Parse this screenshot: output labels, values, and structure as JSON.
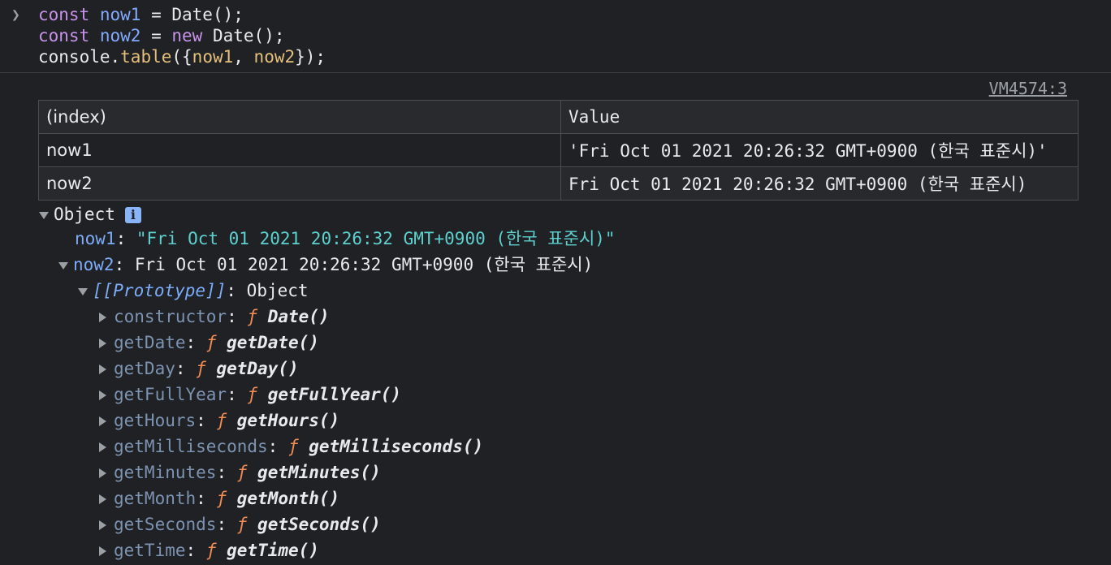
{
  "input": {
    "prompt_icon": "chevron-right",
    "line1": {
      "kw": "const",
      "var": "now1",
      "rest": " = Date();"
    },
    "line2": {
      "kw": "const",
      "var": "now2",
      "op": " = ",
      "kw2": "new",
      "rest": " Date();"
    },
    "line3": {
      "obj": "console.",
      "fn": "table",
      "open": "({",
      "a": "now1",
      "sep": ", ",
      "b": "now2",
      "close": "});"
    }
  },
  "source_link": "VM4574:3",
  "table": {
    "headers": [
      "(index)",
      "Value"
    ],
    "rows": [
      {
        "index": "now1",
        "value": "'Fri Oct 01 2021 20:26:32 GMT+0900 (한국 표준시)'"
      },
      {
        "index": "now2",
        "value": "Fri Oct 01 2021 20:26:32 GMT+0900 (한국 표준시)"
      }
    ]
  },
  "tree": {
    "root_label": "Object",
    "info_icon": "i",
    "now1_key": "now1",
    "now1_value": "\"Fri Oct 01 2021 20:26:32 GMT+0900 (한국 표준시)\"",
    "now2_key": "now2",
    "now2_value": "Fri Oct 01 2021 20:26:32 GMT+0900 (한국 표준시)",
    "proto_key": "[[Prototype]]",
    "proto_value": "Object",
    "f_glyph": "ƒ",
    "methods": [
      {
        "key": "constructor",
        "fn": "Date()"
      },
      {
        "key": "getDate",
        "fn": "getDate()"
      },
      {
        "key": "getDay",
        "fn": "getDay()"
      },
      {
        "key": "getFullYear",
        "fn": "getFullYear()"
      },
      {
        "key": "getHours",
        "fn": "getHours()"
      },
      {
        "key": "getMilliseconds",
        "fn": "getMilliseconds()"
      },
      {
        "key": "getMinutes",
        "fn": "getMinutes()"
      },
      {
        "key": "getMonth",
        "fn": "getMonth()"
      },
      {
        "key": "getSeconds",
        "fn": "getSeconds()"
      },
      {
        "key": "getTime",
        "fn": "getTime()"
      }
    ]
  },
  "colors": {
    "background": "#202124",
    "string": "#5cd1cf",
    "key": "#7cacf8",
    "function_glyph": "#f28b54"
  }
}
